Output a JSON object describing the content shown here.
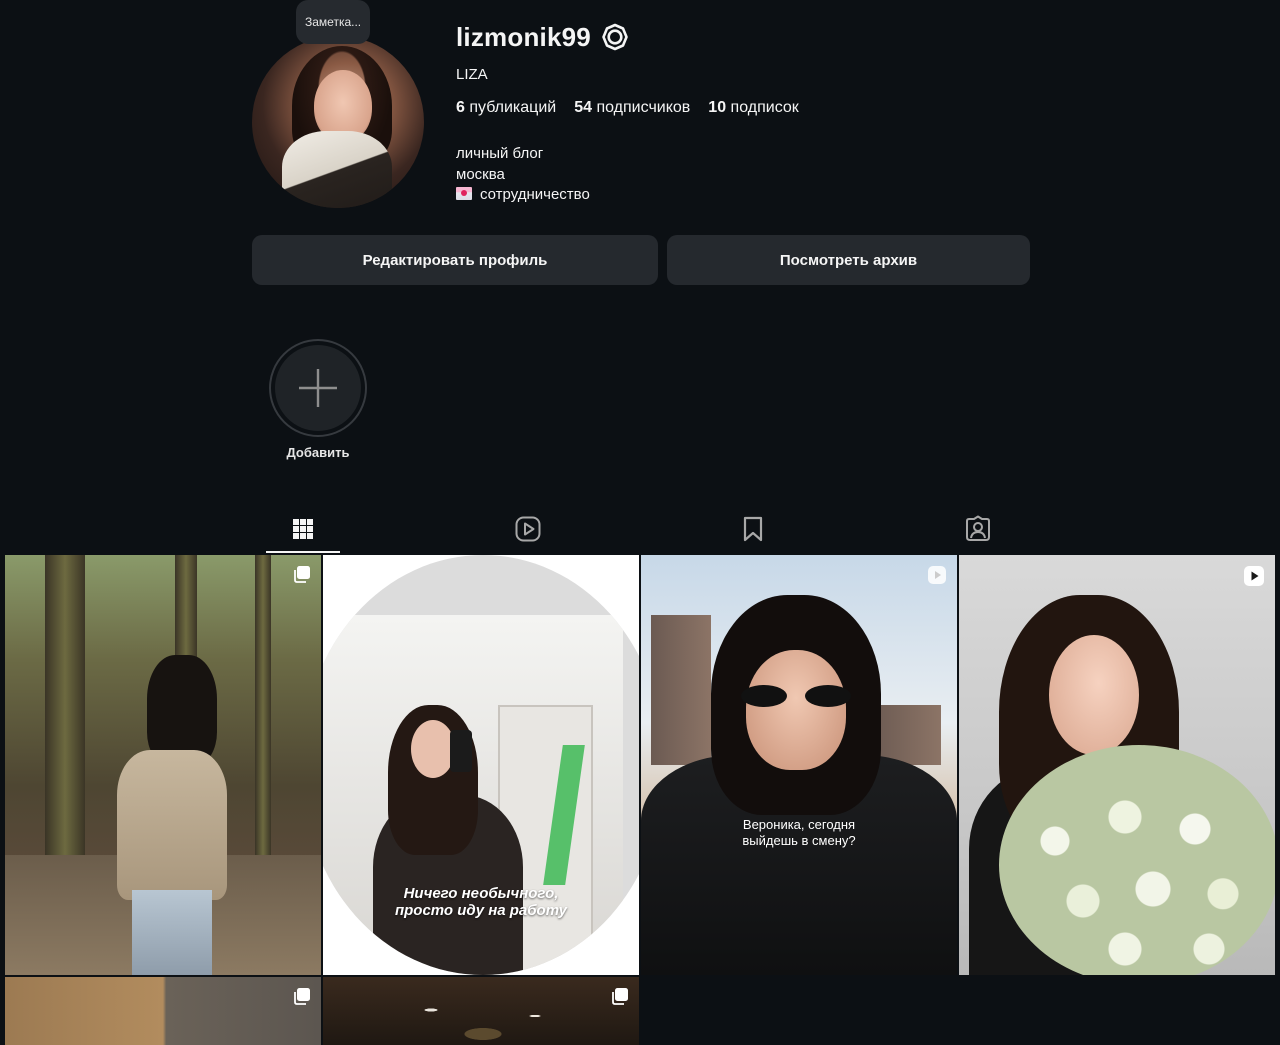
{
  "note": {
    "text": "Заметка..."
  },
  "profile": {
    "username": "lizmonik99",
    "full_name": "LIZA",
    "stats": [
      {
        "count": "6",
        "label": "публикаций"
      },
      {
        "count": "54",
        "label": "подписчиков"
      },
      {
        "count": "10",
        "label": "подписок"
      }
    ],
    "bio": [
      "личный блог",
      "москва",
      "сотрудничество"
    ]
  },
  "buttons": {
    "edit_profile": "Редактировать профиль",
    "view_archive": "Посмотреть архив"
  },
  "highlights": {
    "add_label": "Добавить"
  },
  "tabs": [
    {
      "icon": "grid-icon",
      "active": true
    },
    {
      "icon": "reels-icon",
      "active": false
    },
    {
      "icon": "bookmark-icon",
      "active": false
    },
    {
      "icon": "tagged-icon",
      "active": false
    }
  ],
  "posts": [
    {
      "type": "carousel",
      "badge_icon": "carousel-icon"
    },
    {
      "type": "photo",
      "overlay_text_line1": "Ничего необычного,",
      "overlay_text_line2": "просто иду на работу"
    },
    {
      "type": "reel",
      "badge_icon": "reel-play-icon",
      "overlay_text_line1": "Вероника, сегодня",
      "overlay_text_line2": "выйдешь в смену?"
    },
    {
      "type": "reel",
      "badge_icon": "reel-play-icon"
    },
    {
      "type": "carousel",
      "badge_icon": "carousel-icon"
    },
    {
      "type": "carousel",
      "badge_icon": "carousel-icon"
    }
  ],
  "colors": {
    "background": "#0c1014",
    "button_bg": "#25292e",
    "text": "#f5f5f5"
  }
}
